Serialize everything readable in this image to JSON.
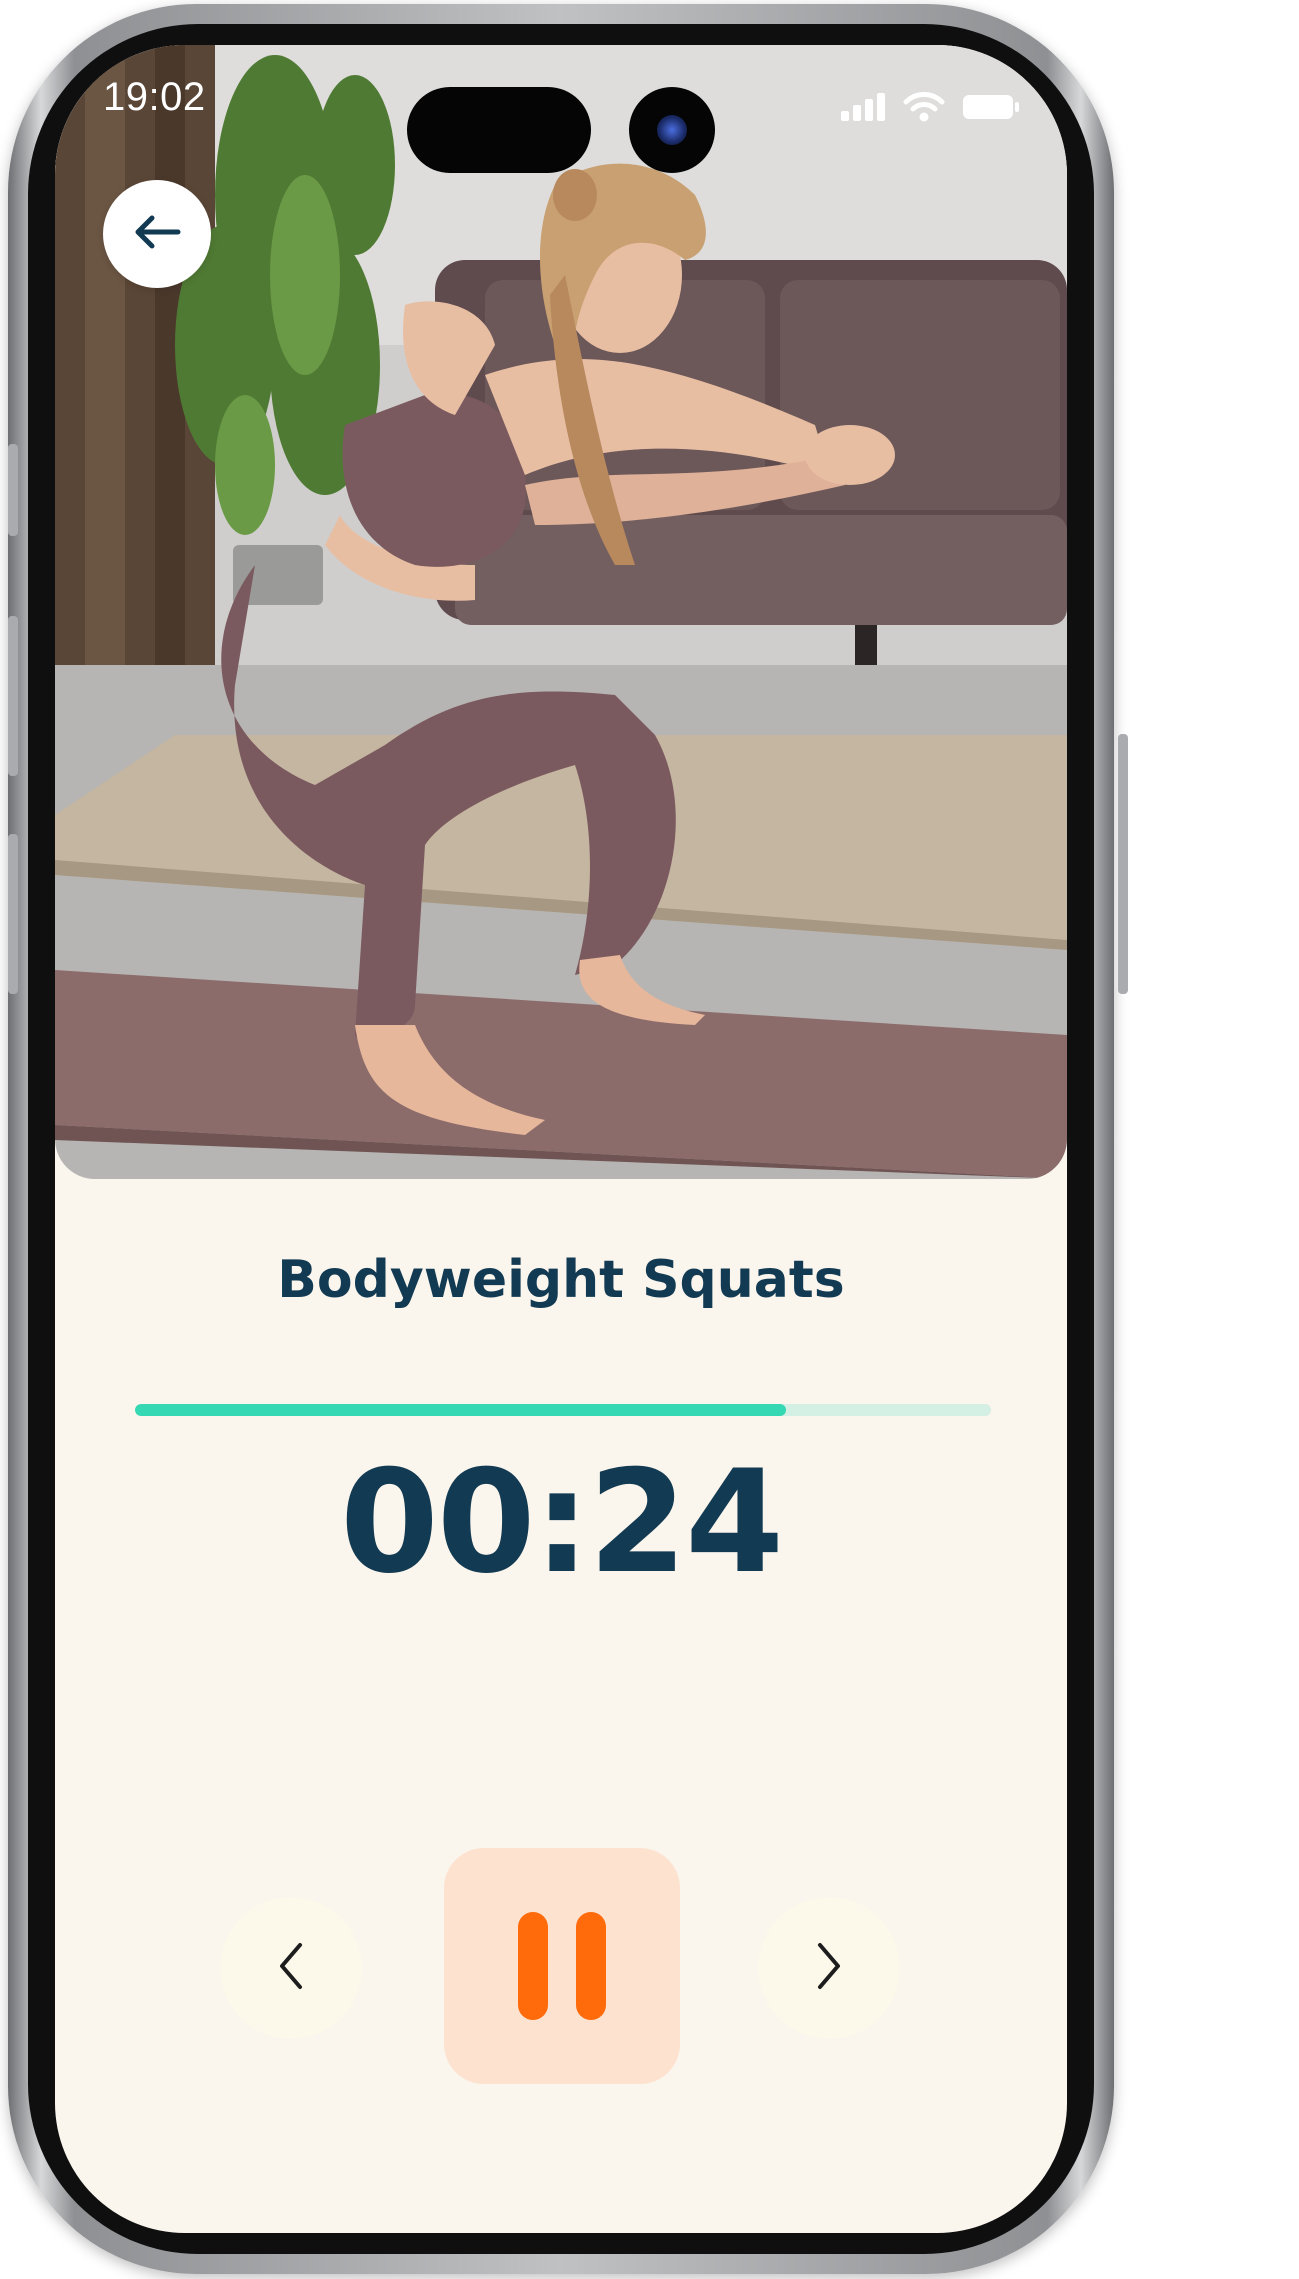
{
  "status_bar": {
    "time": "19:02",
    "icons": [
      "cellular-signal-icon",
      "wifi-icon",
      "battery-icon"
    ]
  },
  "header": {
    "back_icon": "arrow-left-icon"
  },
  "workout": {
    "exercise_name": "Bodyweight Squats",
    "timer": "00:24",
    "progress": 0.76
  },
  "controls": {
    "previous_icon": "chevron-left-icon",
    "pause_icon": "pause-icon",
    "next_icon": "chevron-right-icon"
  },
  "colors": {
    "background": "#faf5ed",
    "title_text": "#123a52",
    "progress_fill": "#34d8b3",
    "progress_track": "#d4efe3",
    "pause_accent": "#ff6a0b",
    "pause_background": "#fde2d0",
    "side_button_background": "#fcf9ea"
  }
}
